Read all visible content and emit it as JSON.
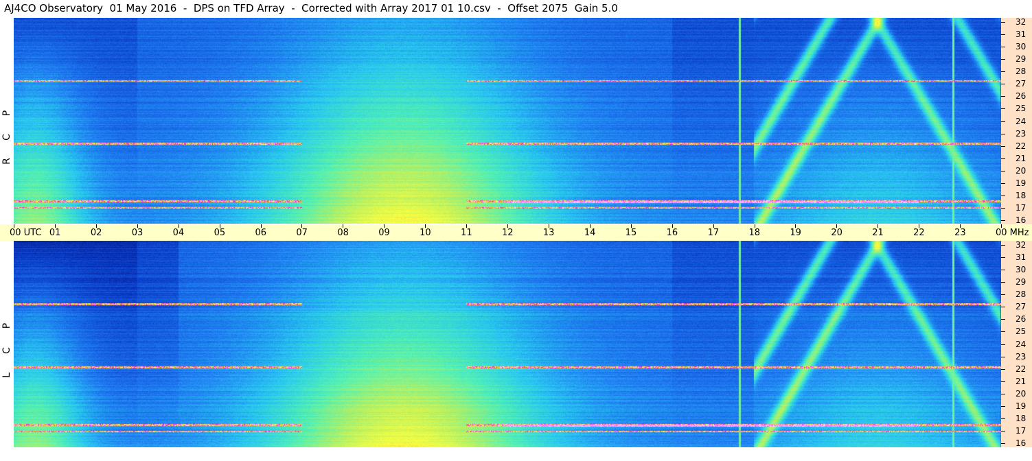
{
  "title": "AJ4CO Observatory  01 May 2016  -  DPS on TFD Array  -  Corrected with Array 2017 01 10.csv  -  Offset 2075  Gain 5.0",
  "panels": [
    {
      "label_letters": [
        "R",
        "C",
        "P"
      ]
    },
    {
      "label_letters": [
        "L",
        "C",
        "P"
      ]
    }
  ],
  "time_axis": {
    "labels": [
      "00 UTC",
      "01",
      "02",
      "03",
      "04",
      "05",
      "06",
      "07",
      "08",
      "09",
      "10",
      "11",
      "12",
      "13",
      "14",
      "15",
      "16",
      "17",
      "18",
      "19",
      "20",
      "21",
      "22",
      "23",
      "00 MHz"
    ]
  },
  "freq_axis": {
    "labels": [
      "32",
      "31",
      "30",
      "29",
      "28",
      "27",
      "26",
      "25",
      "24",
      "23",
      "22",
      "21",
      "20",
      "19",
      "18",
      "17",
      "16"
    ]
  },
  "colors": {
    "time_axis_bg": "#ffffc8",
    "freq_axis_bg": "#ffe1c8",
    "colormap": [
      "#000a6e",
      "#0a3cc8",
      "#1e78f0",
      "#28c8f0",
      "#50f0b4",
      "#b4f064",
      "#ffff3c",
      "#ff783c",
      "#ff00ff",
      "#ffffff"
    ]
  },
  "chart_data": [
    {
      "type": "heatmap",
      "title": "",
      "side_label": "RCP",
      "x": {
        "label": "UTC",
        "range": [
          0,
          24
        ],
        "ticks": [
          0,
          1,
          2,
          3,
          4,
          5,
          6,
          7,
          8,
          9,
          10,
          11,
          12,
          13,
          14,
          15,
          16,
          17,
          18,
          19,
          20,
          21,
          22,
          23,
          24
        ]
      },
      "y": {
        "label": "MHz",
        "range": [
          16,
          32
        ],
        "ticks": [
          16,
          17,
          18,
          19,
          20,
          21,
          22,
          23,
          24,
          25,
          26,
          27,
          28,
          29,
          30,
          31,
          32
        ]
      },
      "features": {
        "broadband_vertical_lines_utc": [
          17.65,
          22.85
        ],
        "daytime_bright_region_utc": [
          7,
          11
        ],
        "rfi_bands_mhz": [
          17.2,
          17.7,
          22.2,
          27.1
        ],
        "jupiter_arc_peaks_utc": [
          19.4,
          21.4,
          22.6
        ]
      }
    },
    {
      "type": "heatmap",
      "title": "",
      "side_label": "LCP",
      "x": {
        "label": "UTC",
        "range": [
          0,
          24
        ],
        "ticks": [
          0,
          1,
          2,
          3,
          4,
          5,
          6,
          7,
          8,
          9,
          10,
          11,
          12,
          13,
          14,
          15,
          16,
          17,
          18,
          19,
          20,
          21,
          22,
          23,
          24
        ]
      },
      "y": {
        "label": "MHz",
        "range": [
          16,
          32
        ],
        "ticks": [
          16,
          17,
          18,
          19,
          20,
          21,
          22,
          23,
          24,
          25,
          26,
          27,
          28,
          29,
          30,
          31,
          32
        ]
      },
      "features": {
        "broadband_vertical_lines_utc": [
          17.65,
          22.85
        ],
        "daytime_bright_region_utc": [
          7,
          11
        ],
        "rfi_bands_mhz": [
          17.2,
          17.7,
          22.2,
          27.1
        ],
        "jupiter_arc_peaks_utc": [
          19.4,
          21.4,
          22.6
        ]
      }
    }
  ]
}
